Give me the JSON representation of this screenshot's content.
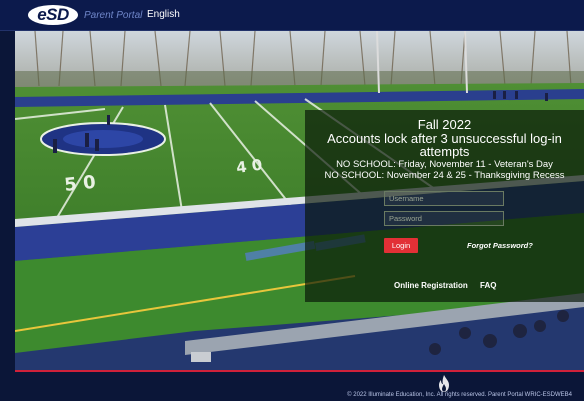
{
  "header": {
    "logo_text": "eSD",
    "logo_subtitle": "Parent Portal",
    "language": "English"
  },
  "announcement": {
    "line1": "Fall 2022",
    "line2": "Accounts lock after 3 unsuccessful log-in attempts",
    "line3": "NO SCHOOL:  Friday, November 11 - Veteran's Day",
    "line4": "NO SCHOOL:  November 24 & 25 - Thanksgiving Recess"
  },
  "login": {
    "username_placeholder": "Username",
    "password_placeholder": "Password",
    "button_label": "Login",
    "forgot_label": "Forgot Password?"
  },
  "links": {
    "registration": "Online Registration",
    "faq": "FAQ"
  },
  "footer": {
    "copyright": "© 2022 Illuminate Education, Inc. All rights reserved. Parent Portal WRIC-ESDWEB4"
  },
  "colors": {
    "header_bg": "#0c1a4c",
    "accent_red": "#e23036",
    "footer_bg": "#0b1638"
  },
  "icons": {
    "footer": "flame-icon"
  }
}
